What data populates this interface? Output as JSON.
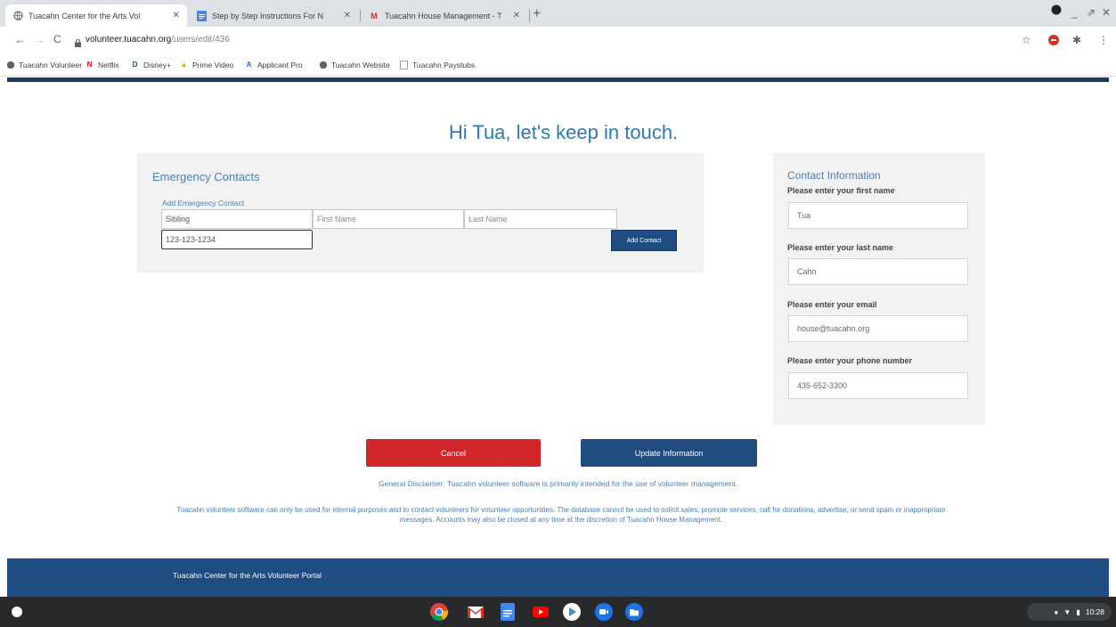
{
  "browser": {
    "tabs": [
      {
        "label": "Tuacahn Center for the Arts Vol",
        "icon": "globe-icon",
        "active": true
      },
      {
        "label": "Step by Step Instructions For N",
        "icon": "docs-icon",
        "active": false
      },
      {
        "label": "Tuacahn House Management - T",
        "icon": "gmail-icon",
        "active": false
      }
    ],
    "new_tab": "+",
    "url_host": "volunteer.tuacahn.org",
    "url_path": "/users/edit/436",
    "bookmarks": [
      {
        "label": "Tuacahn Volunteer",
        "icon": "globe-icon"
      },
      {
        "label": "Netflix",
        "icon": "netflix-icon"
      },
      {
        "label": "Disney+",
        "icon": "disney-icon"
      },
      {
        "label": "Prime Video",
        "icon": "prime-icon"
      },
      {
        "label": "Applicant Pro",
        "icon": "applicantpro-icon"
      },
      {
        "label": "Tuacahn Website",
        "icon": "globe-icon"
      },
      {
        "label": "Tuacahn Paystubs",
        "icon": "page-icon"
      }
    ]
  },
  "page": {
    "greeting": "Hi Tua, let's keep in touch.",
    "emergency": {
      "title": "Emergency Contacts",
      "add_link": "Add Emergency Contact",
      "relationship_value": "Sibling",
      "first_name_placeholder": "First Name",
      "last_name_placeholder": "Last Name",
      "phone_value": "123-123-1234",
      "add_button": "Add Contact"
    },
    "contact": {
      "title": "Contact Information",
      "first_name_label": "Please enter your first name",
      "first_name_value": "Tua",
      "last_name_label": "Please enter your last name",
      "last_name_value": "Cahn",
      "email_label": "Please enter your email",
      "email_value": "house@tuacahn.org",
      "phone_label": "Please enter your phone number",
      "phone_value": "435-652-3300"
    },
    "cancel_button": "Cancel",
    "update_button": "Update Information",
    "disclaimer": "General Disclaimer: Tuacahn volunteer software is primarily intended for the use of volunteer management.",
    "legal": "Tuacahn volunteer software can only be used for internal purposes and to contact volunteers for volunteer opportunities. The database cannot be used to solicit sales, promote services, call for donations, advertise, or send spam or inappropriate messages. Accounts may also be closed at any time at the discretion of Tuacahn House Management.",
    "footer": "Tuacahn Center for the Arts Volunteer Portal"
  },
  "shelf": {
    "apps": [
      "chrome-icon",
      "gmail-icon",
      "docs-icon",
      "youtube-icon",
      "play-store-icon",
      "meet-icon",
      "files-icon"
    ],
    "time": "10:28"
  },
  "colors": {
    "accent": "#2e7bb0",
    "navy": "#1f4d82",
    "cancel": "#d0252b"
  }
}
